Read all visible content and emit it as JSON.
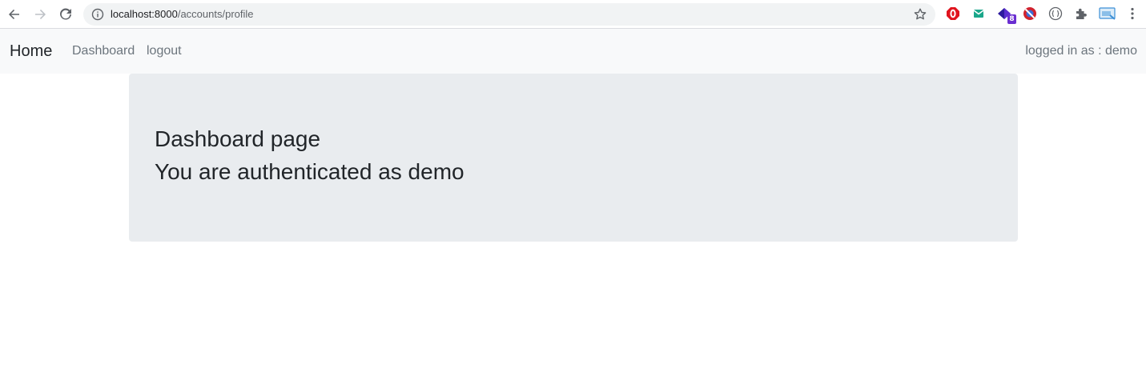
{
  "browser": {
    "url_host": "localhost:8000",
    "url_path": "/accounts/profile",
    "extensions": [
      {
        "name": "opera-stop-icon",
        "color": "#e0141e"
      },
      {
        "name": "mail-icon",
        "color": "#1aa68a"
      },
      {
        "name": "purple-extension-icon",
        "color": "#5b2ed0"
      },
      {
        "name": "block-icon",
        "color": "#d1222e"
      },
      {
        "name": "code-braces-icon",
        "color": "#5f6368"
      },
      {
        "name": "puzzle-icon",
        "color": "#5f6368"
      },
      {
        "name": "screenshot-icon",
        "color": "#3b8fd6"
      }
    ],
    "extension_badge": "8"
  },
  "navbar": {
    "brand": "Home",
    "links": [
      "Dashboard",
      "logout"
    ],
    "status": "logged in as : demo"
  },
  "main": {
    "title": "Dashboard page",
    "message": "You are authenticated as demo"
  },
  "colors": {
    "navbar_bg": "#f8f9fa",
    "jumbotron_bg": "#e9ecef",
    "text_dark": "#212529",
    "text_muted": "#6c757d"
  }
}
